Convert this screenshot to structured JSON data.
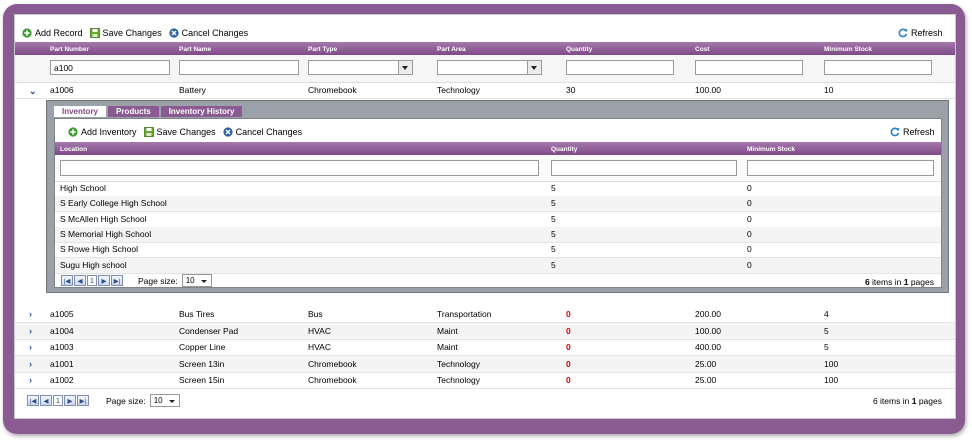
{
  "toolbar": {
    "add_record": "Add Record",
    "save_changes": "Save Changes",
    "cancel_changes": "Cancel Changes",
    "refresh": "Refresh"
  },
  "grid": {
    "columns": [
      "Part Number",
      "Part Name",
      "Part Type",
      "Part Area",
      "Quantity",
      "Cost",
      "Minimum Stock"
    ],
    "filter_part_number": "a100",
    "expanded_row": {
      "part_number": "a1006",
      "part_name": "Battery",
      "part_type": "Chromebook",
      "part_area": "Technology",
      "quantity": "30",
      "cost": "100.00",
      "minimum_stock": "10"
    },
    "rows": [
      {
        "part_number": "a1005",
        "part_name": "Bus Tires",
        "part_type": "Bus",
        "part_area": "Transportation",
        "quantity": "0",
        "cost": "200.00",
        "minimum_stock": "4"
      },
      {
        "part_number": "a1004",
        "part_name": "Condenser Pad",
        "part_type": "HVAC",
        "part_area": "Maint",
        "quantity": "0",
        "cost": "100.00",
        "minimum_stock": "5"
      },
      {
        "part_number": "a1003",
        "part_name": "Copper Line",
        "part_type": "HVAC",
        "part_area": "Maint",
        "quantity": "0",
        "cost": "400.00",
        "minimum_stock": "5"
      },
      {
        "part_number": "a1001",
        "part_name": "Screen 13in",
        "part_type": "Chromebook",
        "part_area": "Technology",
        "quantity": "0",
        "cost": "25.00",
        "minimum_stock": "100"
      },
      {
        "part_number": "a1002",
        "part_name": "Screen 15in",
        "part_type": "Chromebook",
        "part_area": "Technology",
        "quantity": "0",
        "cost": "25.00",
        "minimum_stock": "100"
      }
    ],
    "pager": {
      "page": "1",
      "page_size_label": "Page size:",
      "page_size": "10",
      "items_count": "6",
      "items_in": "items in",
      "pages_count": "1",
      "pages_label": "pages"
    }
  },
  "detail": {
    "tabs": [
      "Inventory",
      "Products",
      "Inventory History"
    ],
    "toolbar": {
      "add": "Add Inventory",
      "save": "Save Changes",
      "cancel": "Cancel Changes",
      "refresh": "Refresh"
    },
    "columns": [
      "Location",
      "Quantity",
      "Minimum Stock"
    ],
    "rows": [
      {
        "location": "High School",
        "quantity": "5",
        "minimum_stock": "0"
      },
      {
        "location": "S Early College High School",
        "quantity": "5",
        "minimum_stock": "0"
      },
      {
        "location": "S McAllen High School",
        "quantity": "5",
        "minimum_stock": "0"
      },
      {
        "location": "S Memorial High School",
        "quantity": "5",
        "minimum_stock": "0"
      },
      {
        "location": "S Rowe High School",
        "quantity": "5",
        "minimum_stock": "0"
      },
      {
        "location": "Sugu High school",
        "quantity": "5",
        "minimum_stock": "0"
      }
    ],
    "pager": {
      "page": "1",
      "page_size_label": "Page size:",
      "page_size": "10",
      "items_count": "6",
      "items_in": "items in",
      "pages_count": "1",
      "pages_label": "pages"
    }
  },
  "icons": {
    "add": "plus-circle-icon",
    "save": "floppy-disk-icon",
    "cancel": "cancel-circle-icon",
    "refresh": "refresh-icon",
    "expand": "chevron-right-icon",
    "collapse": "chevron-down-icon"
  },
  "colors": {
    "frame": "#8a5a92",
    "header": "#8f5f97",
    "detail_bg": "#9aa1a8",
    "zero_qty": "#d40000",
    "link_blue": "#2a4d8f"
  }
}
